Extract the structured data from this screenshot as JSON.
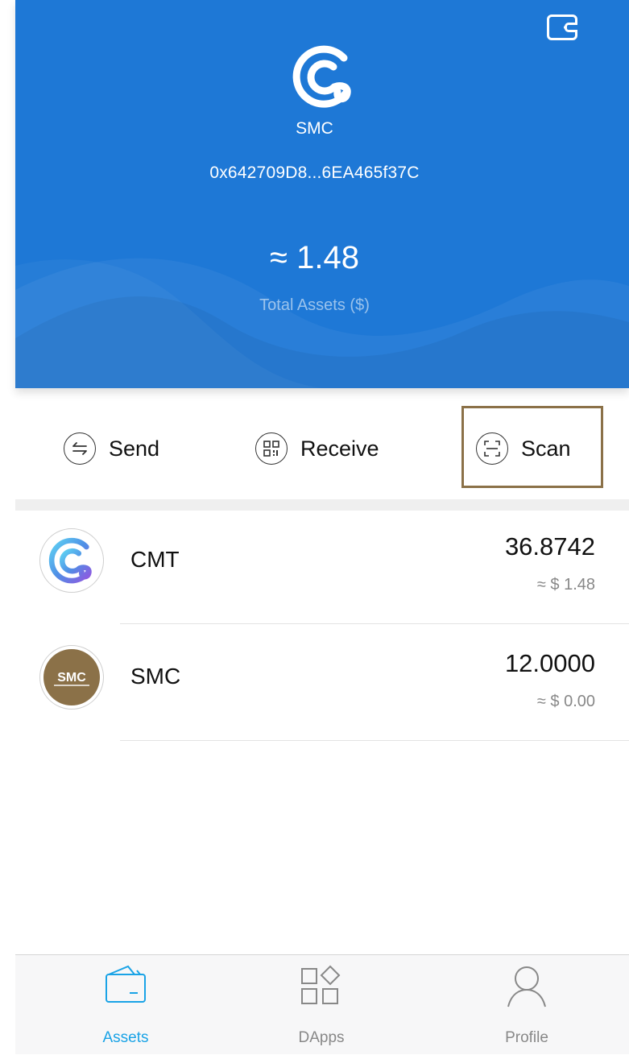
{
  "header": {
    "wallet_name": "SMC",
    "address": "0x642709D8...6EA465f37C",
    "total_value": "≈ 1.48",
    "total_label": "Total Assets ($)",
    "icons": {
      "logo": "cybermiles-logo",
      "wallet": "wallet-icon"
    },
    "background_color": "#1e78d6"
  },
  "actions": [
    {
      "label": "Send",
      "icon": "transfer-arrows-icon"
    },
    {
      "label": "Receive",
      "icon": "qr-code-icon"
    },
    {
      "label": "Scan",
      "icon": "scan-frame-icon"
    }
  ],
  "assets": [
    {
      "symbol": "CMT",
      "amount": "36.8742",
      "usd": "≈ $ 1.48",
      "icon": "cmt-token-logo"
    },
    {
      "symbol": "SMC",
      "amount": "12.0000",
      "usd": "≈ $ 0.00",
      "icon": "smc-token-logo"
    }
  ],
  "tabbar": {
    "tabs": [
      {
        "label": "Assets",
        "icon": "wallet-tab-icon",
        "active": true
      },
      {
        "label": "DApps",
        "icon": "dapps-grid-icon",
        "active": false
      },
      {
        "label": "Profile",
        "icon": "person-icon",
        "active": false
      }
    ],
    "active_color": "#1aa3e6"
  },
  "highlight_color": "#8b7148"
}
